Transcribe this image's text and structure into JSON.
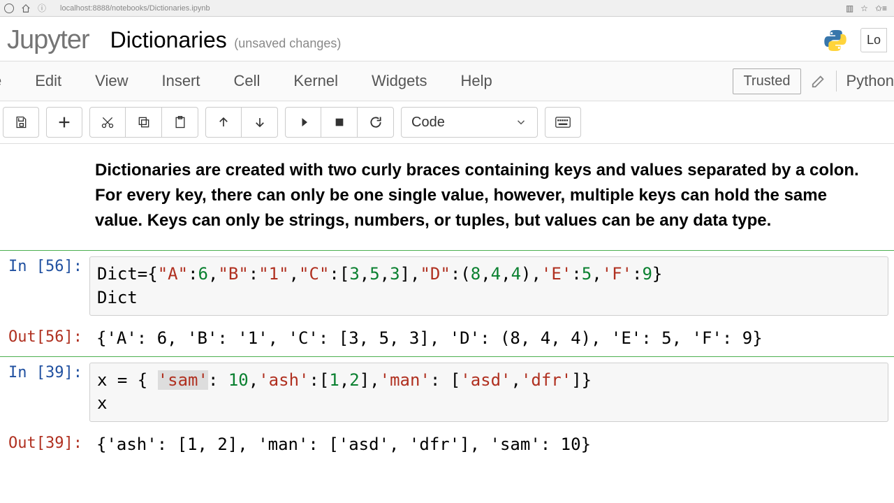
{
  "browser": {
    "url": "localhost:8888/notebooks/Dictionaries.ipynb"
  },
  "header": {
    "logo": "Jupyter",
    "title": "Dictionaries",
    "status": "(unsaved changes)",
    "logout_cut": "Lo"
  },
  "menubar": {
    "items": [
      "e",
      "Edit",
      "View",
      "Insert",
      "Cell",
      "Kernel",
      "Widgets",
      "Help"
    ],
    "trusted": "Trusted",
    "kernel": "Python"
  },
  "toolbar": {
    "cell_type": "Code"
  },
  "cells": {
    "md": "Dictionaries are created with two curly braces containing keys and values separated by a colon. For every key, there can only be one single value, however, multiple keys can hold the same value. Keys can only be strings, numbers, or tuples, but values can be any data type.",
    "in56_label": "In [56]:",
    "in56_code_tokens": [
      {
        "t": "Dict={",
        "c": ""
      },
      {
        "t": "\"A\"",
        "c": "str"
      },
      {
        "t": ":",
        "c": ""
      },
      {
        "t": "6",
        "c": "num"
      },
      {
        "t": ",",
        "c": ""
      },
      {
        "t": "\"B\"",
        "c": "str"
      },
      {
        "t": ":",
        "c": ""
      },
      {
        "t": "\"1\"",
        "c": "str"
      },
      {
        "t": ",",
        "c": ""
      },
      {
        "t": "\"C\"",
        "c": "str"
      },
      {
        "t": ":[",
        "c": ""
      },
      {
        "t": "3",
        "c": "num"
      },
      {
        "t": ",",
        "c": ""
      },
      {
        "t": "5",
        "c": "num"
      },
      {
        "t": ",",
        "c": ""
      },
      {
        "t": "3",
        "c": "num"
      },
      {
        "t": "],",
        "c": ""
      },
      {
        "t": "\"D\"",
        "c": "str"
      },
      {
        "t": ":(",
        "c": ""
      },
      {
        "t": "8",
        "c": "num"
      },
      {
        "t": ",",
        "c": ""
      },
      {
        "t": "4",
        "c": "num"
      },
      {
        "t": ",",
        "c": ""
      },
      {
        "t": "4",
        "c": "num"
      },
      {
        "t": "),",
        "c": ""
      },
      {
        "t": "'E'",
        "c": "str"
      },
      {
        "t": ":",
        "c": ""
      },
      {
        "t": "5",
        "c": "num"
      },
      {
        "t": ",",
        "c": ""
      },
      {
        "t": "'F'",
        "c": "str"
      },
      {
        "t": ":",
        "c": ""
      },
      {
        "t": "9",
        "c": "num"
      },
      {
        "t": "}",
        "c": ""
      },
      {
        "t": "\nDict",
        "c": ""
      }
    ],
    "out56_label": "Out[56]:",
    "out56": "{'A': 6, 'B': '1', 'C': [3, 5, 3], 'D': (8, 4, 4), 'E': 5, 'F': 9}",
    "in39_label": "In [39]:",
    "in39_code_tokens": [
      {
        "t": "x = { ",
        "c": ""
      },
      {
        "t": "'sam'",
        "c": "str hl"
      },
      {
        "t": ": ",
        "c": ""
      },
      {
        "t": "10",
        "c": "num"
      },
      {
        "t": ",",
        "c": ""
      },
      {
        "t": "'ash'",
        "c": "str"
      },
      {
        "t": ":[",
        "c": ""
      },
      {
        "t": "1",
        "c": "num"
      },
      {
        "t": ",",
        "c": ""
      },
      {
        "t": "2",
        "c": "num"
      },
      {
        "t": "],",
        "c": ""
      },
      {
        "t": "'man'",
        "c": "str"
      },
      {
        "t": ": [",
        "c": ""
      },
      {
        "t": "'asd'",
        "c": "str"
      },
      {
        "t": ",",
        "c": ""
      },
      {
        "t": "'dfr'",
        "c": "str"
      },
      {
        "t": "]}",
        "c": ""
      },
      {
        "t": "\nx",
        "c": ""
      }
    ],
    "out39_label": "Out[39]:",
    "out39": "{'ash': [1, 2], 'man': ['asd', 'dfr'], 'sam': 10}"
  }
}
